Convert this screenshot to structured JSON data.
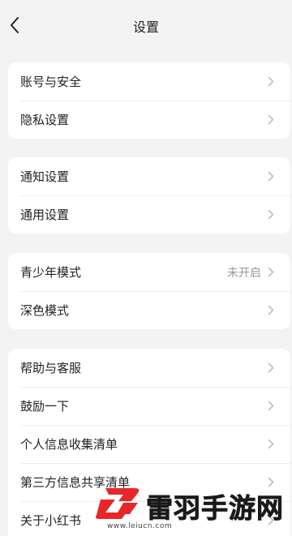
{
  "header": {
    "title": "设置"
  },
  "groups": [
    {
      "items": [
        {
          "label": "账号与安全"
        },
        {
          "label": "隐私设置"
        }
      ]
    },
    {
      "items": [
        {
          "label": "通知设置"
        },
        {
          "label": "通用设置"
        }
      ]
    },
    {
      "items": [
        {
          "label": "青少年模式",
          "value": "未开启"
        },
        {
          "label": "深色模式"
        }
      ]
    },
    {
      "items": [
        {
          "label": "帮助与客服"
        },
        {
          "label": "鼓励一下"
        },
        {
          "label": "个人信息收集清单"
        },
        {
          "label": "第三方信息共享清单"
        },
        {
          "label": "关于小红书"
        }
      ]
    }
  ],
  "watermark": {
    "text": "雷羽手游网",
    "url": "www.leiucn.com"
  },
  "colors": {
    "background": "#f3f3f3",
    "card": "#ffffff",
    "watermark_red": "#e8262a"
  }
}
